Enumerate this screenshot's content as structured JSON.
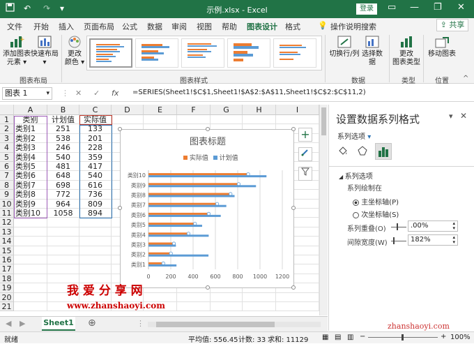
{
  "window": {
    "title": "示例.xlsx  -  Excel",
    "login": "登录",
    "minimize": "—",
    "restore": "❐",
    "close": "✕"
  },
  "qat": {
    "save_icon": "save-icon",
    "undo": "↶",
    "redo": "↷",
    "customize": "▾"
  },
  "tabs": [
    "文件",
    "开始",
    "插入",
    "页面布局",
    "公式",
    "数据",
    "审阅",
    "视图",
    "帮助",
    "图表设计",
    "格式"
  ],
  "active_tab": "图表设计",
  "tell_me": "操作说明搜索",
  "share": "共享",
  "ribbon": {
    "add_element": "添加图表\n元素 ▾",
    "quick_layout": "快速布局\n▾",
    "change_colors": "更改\n颜色 ▾",
    "switch_rowcol": "切换行/列",
    "select_data": "选择数据",
    "change_type": "更改\n图表类型",
    "move_chart": "移动图表",
    "groups": {
      "layout": "图表布局",
      "styles": "图表样式",
      "data": "数据",
      "type": "类型",
      "location": "位置"
    }
  },
  "formula_bar": {
    "name_box": "图表 1",
    "cancel": "✕",
    "enter": "✓",
    "fx": "fx",
    "formula": "=SERIES(Sheet1!$C$1,Sheet1!$A$2:$A$11,Sheet1!$C$2:$C$11,2)"
  },
  "columns": [
    "A",
    "B",
    "C",
    "D",
    "E",
    "F",
    "G",
    "H",
    "I"
  ],
  "rows": [
    "1",
    "2",
    "3",
    "4",
    "5",
    "6",
    "7",
    "8",
    "9",
    "10",
    "11",
    "12",
    "13",
    "14",
    "15",
    "16",
    "17",
    "18",
    "19",
    "20",
    "21"
  ],
  "table": {
    "headers": [
      "类别",
      "计划值",
      "实际值"
    ],
    "rows": [
      [
        "类别1",
        "251",
        "133"
      ],
      [
        "类别2",
        "538",
        "201"
      ],
      [
        "类别3",
        "246",
        "228"
      ],
      [
        "类别4",
        "540",
        "359"
      ],
      [
        "类别5",
        "481",
        "417"
      ],
      [
        "类别6",
        "648",
        "540"
      ],
      [
        "类别7",
        "698",
        "616"
      ],
      [
        "类别8",
        "772",
        "736"
      ],
      [
        "类别9",
        "964",
        "809"
      ],
      [
        "类别10",
        "1058",
        "894"
      ]
    ]
  },
  "chart_data": {
    "type": "bar",
    "title": "图表标题",
    "categories": [
      "类别1",
      "类别2",
      "类别3",
      "类别4",
      "类别5",
      "类别6",
      "类别7",
      "类别8",
      "类别9",
      "类别10"
    ],
    "series": [
      {
        "name": "实际值",
        "values": [
          133,
          201,
          228,
          359,
          417,
          540,
          616,
          736,
          809,
          894
        ],
        "color": "#ED7D31"
      },
      {
        "name": "计划值",
        "values": [
          251,
          538,
          246,
          540,
          481,
          648,
          698,
          772,
          964,
          1058
        ],
        "color": "#5B9BD5"
      }
    ],
    "xlim": [
      0,
      1200
    ],
    "xticks": [
      "0",
      "200",
      "400",
      "600",
      "800",
      "1000",
      "1200"
    ],
    "legend": "top",
    "orientation": "horizontal",
    "grid": true
  },
  "pane": {
    "title": "设置数据系列格式",
    "options_dropdown": "系列选项",
    "section": "系列选项",
    "plot_on": "系列绘制在",
    "primary_axis": "主坐标轴(P)",
    "secondary_axis": "次坐标轴(S)",
    "overlap_label": "系列重叠(O)",
    "overlap_value": ".00%",
    "gap_label": "间隙宽度(W)",
    "gap_value": "182%"
  },
  "sheet_tab": "Sheet1",
  "status": {
    "ready": "就绪",
    "average": "平均值: 556.45",
    "count": "计数: 33",
    "sum": "求和: 11129",
    "zoom": "100%"
  },
  "watermark": {
    "cn": "我 爱 分 享 网",
    "url": "www.zhanshaoyi.com",
    "corner": "zhanshaoyi.com"
  },
  "colors": {
    "excel_green": "#217346",
    "orange": "#ED7D31",
    "blue": "#5B9BD5"
  }
}
